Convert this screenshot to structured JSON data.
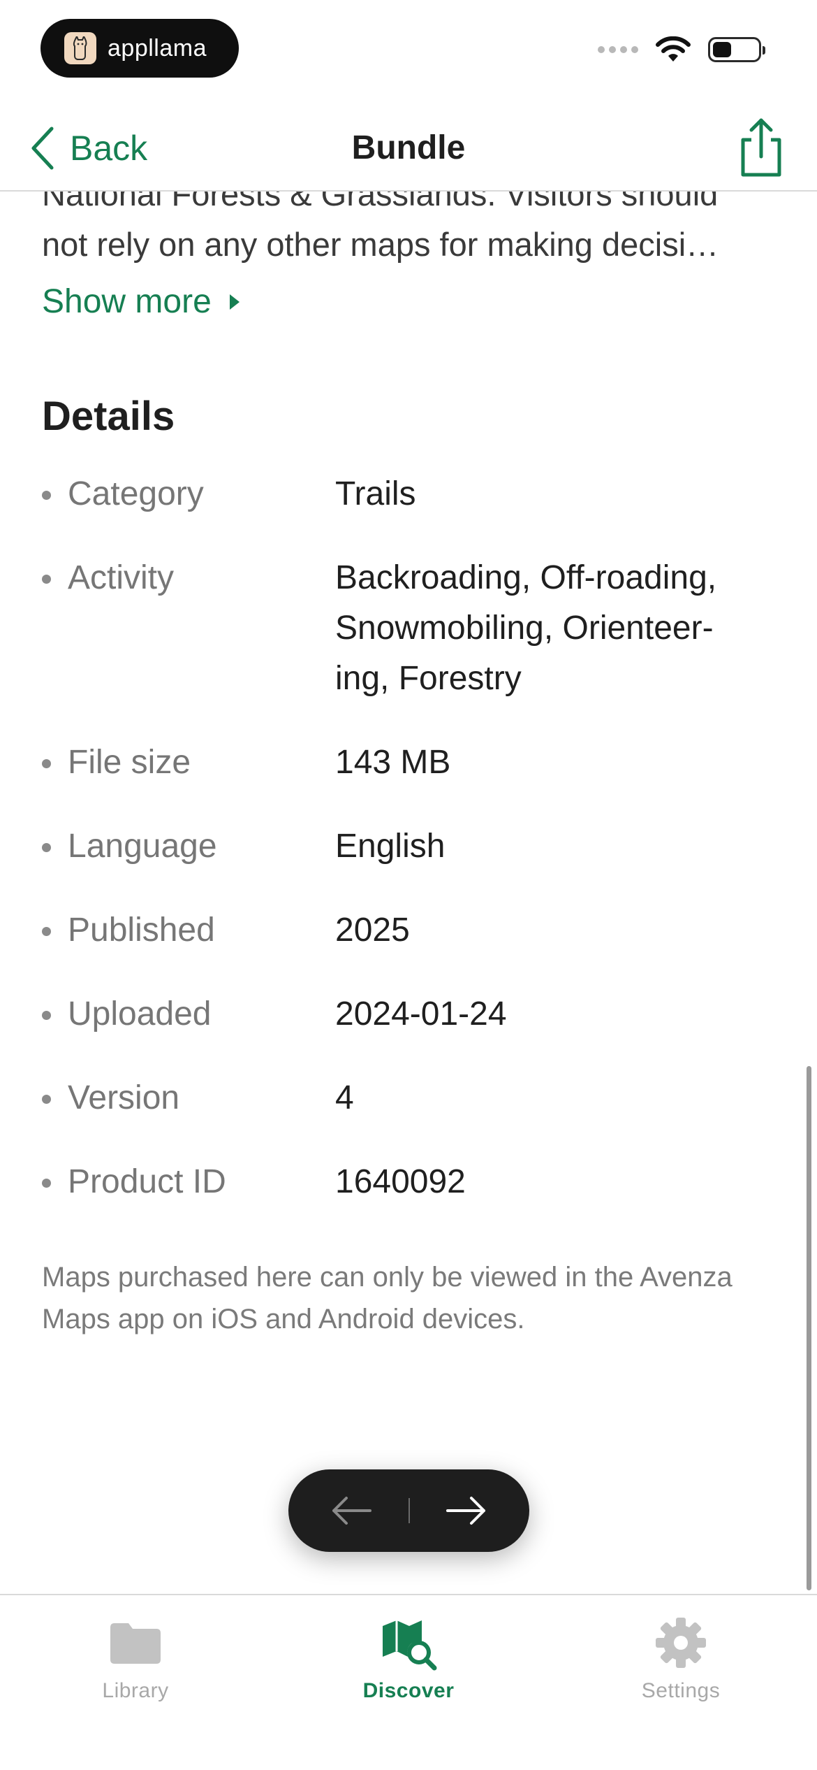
{
  "status_bar": {
    "brand_name": "appllama",
    "battery_level_percent": 40
  },
  "nav": {
    "back_label": "Back",
    "title": "Bundle"
  },
  "description": {
    "line1": "National Forests & Grasslands. Visitors should",
    "line2": "not rely on any other maps for making decisi…",
    "show_more_label": "Show more"
  },
  "details": {
    "heading": "Details",
    "rows": [
      {
        "label": "Category",
        "value": "Trails"
      },
      {
        "label": "Activity",
        "value": "Backroading, Off-roading, Snowmobiling, Orienteer-ing, Forestry"
      },
      {
        "label": "File size",
        "value": "143 MB"
      },
      {
        "label": "Language",
        "value": "English"
      },
      {
        "label": "Published",
        "value": "2025"
      },
      {
        "label": "Uploaded",
        "value": "2024-01-24"
      },
      {
        "label": "Version",
        "value": "4"
      },
      {
        "label": "Product ID",
        "value": "1640092"
      }
    ]
  },
  "disclaimer": "Maps purchased here can only be viewed in the Avenza Maps app on iOS and Android devices.",
  "tabs": [
    {
      "label": "Library",
      "icon": "folder-icon",
      "active": false
    },
    {
      "label": "Discover",
      "icon": "map-search-icon",
      "active": true
    },
    {
      "label": "Settings",
      "icon": "gear-icon",
      "active": false
    }
  ],
  "colors": {
    "accent": "#167f52",
    "inactive_tab": "#a8a8a8",
    "pager_bg": "#1e1e1e"
  }
}
